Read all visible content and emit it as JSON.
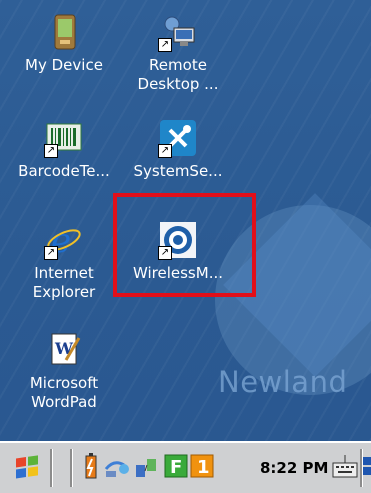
{
  "icons": [
    {
      "label_lines": [
        "My Device"
      ],
      "icon": "pda-device-icon"
    },
    {
      "label_lines": [
        "Remote",
        "Desktop ..."
      ],
      "icon": "remote-desktop-icon"
    },
    {
      "label_lines": [
        "BarcodeTe..."
      ],
      "icon": "barcode-icon"
    },
    {
      "label_lines": [
        "SystemSe..."
      ],
      "icon": "tools-icon"
    },
    {
      "label_lines": [
        "Internet",
        "Explorer"
      ],
      "icon": "internet-explorer-icon"
    },
    {
      "label_lines": [
        "WirelessM..."
      ],
      "icon": "wireless-manager-icon"
    },
    {
      "label_lines": [
        "Microsoft",
        "WordPad"
      ],
      "icon": "wordpad-icon"
    }
  ],
  "watermark": {
    "text": "Newland"
  },
  "taskbar": {
    "time": "8:22 PM"
  },
  "colors": {
    "desktop": "#2d5b93",
    "highlight": "#e10f1a",
    "taskbar": "#cfd0d2"
  }
}
